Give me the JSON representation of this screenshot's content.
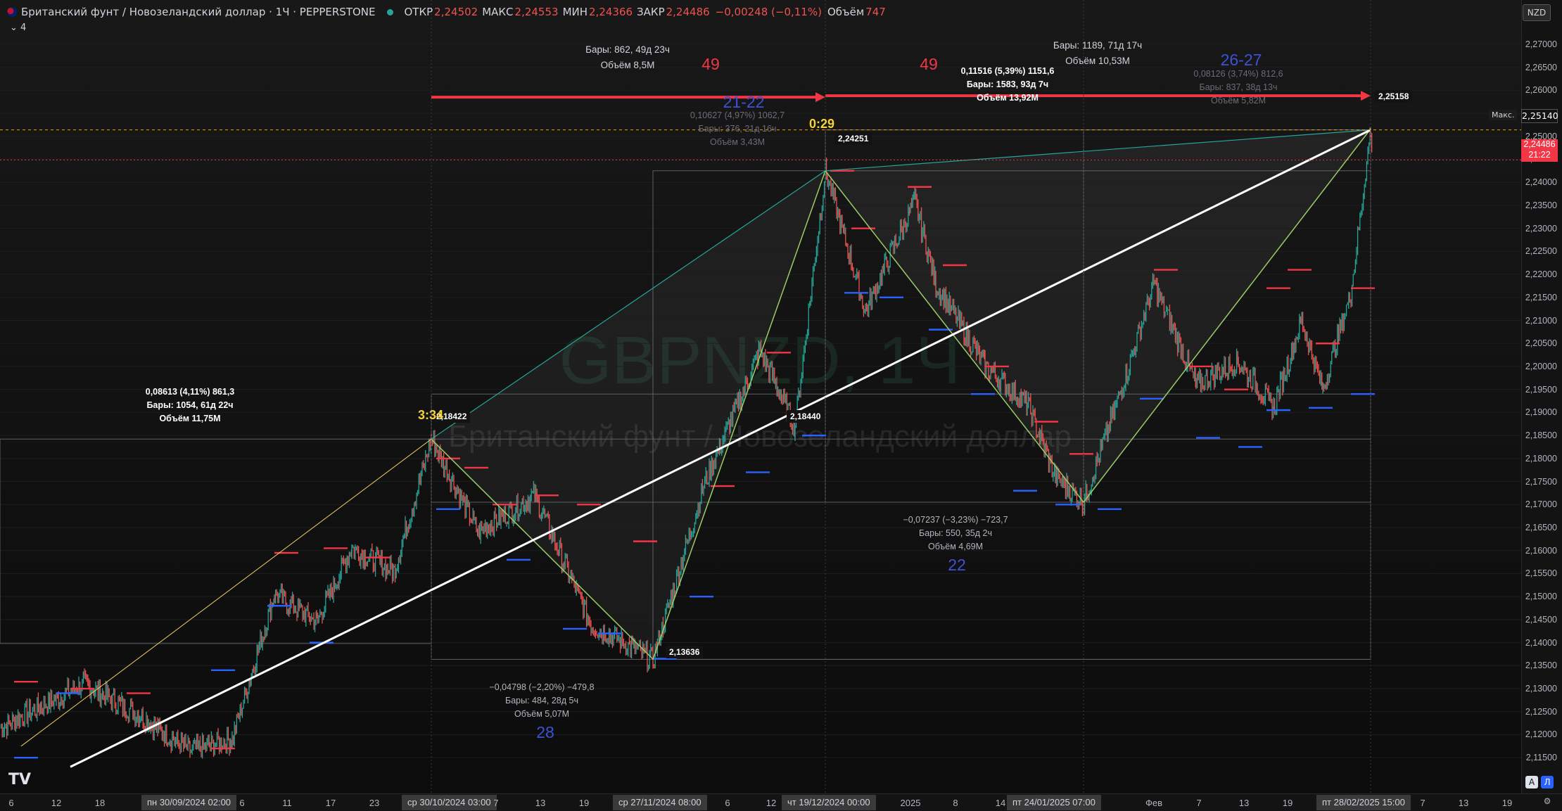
{
  "legend": {
    "title": "Британский фунт / Новозеландский доллар · 1Ч · PEPPERSTONE",
    "open_label": "ОТКР",
    "open": "2,24502",
    "high_label": "МАКС",
    "high": "2,24553",
    "low_label": "МИН",
    "low": "2,24366",
    "close_label": "ЗАКР",
    "close": "2,24486",
    "change": "−0,00248 (−0,11%)",
    "volume_label": "Объём",
    "volume": "747",
    "indicators_count": "4"
  },
  "watermark": {
    "symbol": "GBPNZD, 1Ч",
    "name": "Британский фунт / Новозеландский доллар"
  },
  "currency_button": "NZD",
  "max_label": "Макс.",
  "max_price": "2,25140",
  "close_tag": {
    "price": "2,24486",
    "countdown": "21:22"
  },
  "chart_data": {
    "type": "line",
    "symbol": "GBPNZD",
    "timeframe": "1Ч",
    "exchange": "PEPPERSTONE",
    "ylim": [
      2.1135,
      2.2735
    ],
    "y_ticks": [
      "2,27000",
      "2,26500",
      "2,26000",
      "2,25500",
      "2,25000",
      "2,24500",
      "2,24000",
      "2,23500",
      "2,23000",
      "2,22500",
      "2,22000",
      "2,21500",
      "2,21000",
      "2,20500",
      "2,20000",
      "2,19500",
      "2,19000",
      "2,18500",
      "2,18000",
      "2,17500",
      "2,17000",
      "2,16500",
      "2,16000",
      "2,15500",
      "2,15000",
      "2,14500",
      "2,14000",
      "2,13500",
      "2,13000",
      "2,12500",
      "2,12000",
      "2,11500"
    ],
    "x_ticks": [
      "6",
      "12",
      "18",
      "пн 30/09/2024  02:00",
      "6",
      "11",
      "17",
      "23",
      "ср 30/10/2024  03:00",
      "7",
      "13",
      "19",
      "ср 27/11/2024  08:00",
      "6",
      "12",
      "чт 19/12/2024  00:00",
      "2025",
      "8",
      "14",
      "пт 24/01/2025  07:00",
      "Фев",
      "7",
      "13",
      "19",
      "пт 28/02/2025  15:00",
      "7",
      "13",
      "19"
    ],
    "x_highlighted": [
      "пн 30/09/2024  02:00",
      "ср 30/10/2024  03:00",
      "ср 27/11/2024  08:00",
      "чт 19/12/2024  00:00",
      "пт 24/01/2025  07:00",
      "пт 28/02/2025  15:00"
    ],
    "pivots": [
      {
        "x": "2024-10-30 03:00",
        "price": 2.18422,
        "label": "2,18422",
        "time_label": "3:34"
      },
      {
        "x": "2024-11-27 08:00",
        "price": 2.13636,
        "label": "2,13636"
      },
      {
        "x": "2024-12-19 00:00",
        "price": 2.24251,
        "label": "2,24251",
        "time_label": "0:29"
      },
      {
        "x": "2024-12-25 00:00",
        "price": 2.1844,
        "label": "2,18440"
      },
      {
        "x": "2025-01-24 07:00",
        "price": 2.1705,
        "label": ""
      },
      {
        "x": "2025-02-28 15:00",
        "price": 2.25158,
        "label": "2,25158"
      }
    ],
    "trend_line": {
      "from_price": 2.113,
      "to_price": 2.2514
    },
    "zigzag": [
      2.1842,
      2.1364,
      2.2425,
      2.1705,
      2.2516
    ],
    "range_measures": [
      {
        "text": "0,08613 (4,11%) 861,3",
        "bars": "Бары: 1054, 61д 22ч",
        "volume": "Объём 11,75M"
      },
      {
        "text": "−0,04798 (−2,20%) −479,8",
        "bars": "Бары: 484, 28д 5ч",
        "volume": "Объём 5,07M"
      },
      {
        "text": "0,10627 (4,97%) 1062,7",
        "bars": "Бары: 376, 21д 16ч",
        "volume": "Объём 3,43M"
      },
      {
        "text": "0,11516 (5,39%) 1151,6",
        "bars": "Бары: 1583, 93д 7ч",
        "volume": "Объём 13,92M"
      },
      {
        "text": "−0,07237 (−3,23%) −723,7",
        "bars": "Бары: 550, 35д 2ч",
        "volume": "Объём 4,69M"
      },
      {
        "text": "0,08126 (3,74%) 812,6",
        "bars": "Бары: 837, 38д 13ч",
        "volume": "Объём 5,82M"
      }
    ],
    "period_measures": [
      {
        "bars": "Бары: 862, 49д 23ч",
        "volume": "Объём 8,5M",
        "count": "49"
      },
      {
        "bars": "Бары: 1189, 71д 17ч",
        "volume": "Объём 10,53M",
        "count": "49"
      }
    ],
    "counts": [
      "21-22",
      "28",
      "22",
      "26-27"
    ],
    "colors": {
      "up": "#26a69a",
      "down": "#ef5350",
      "trend": "#ffffff",
      "zigzag": "#9ccc65",
      "fib": "#f0d060",
      "swing_high": "#f23645",
      "swing_low": "#2962ff",
      "count_blue": "#3f51d5",
      "count_red": "#f23645",
      "time_label": "#f5d33a"
    }
  }
}
